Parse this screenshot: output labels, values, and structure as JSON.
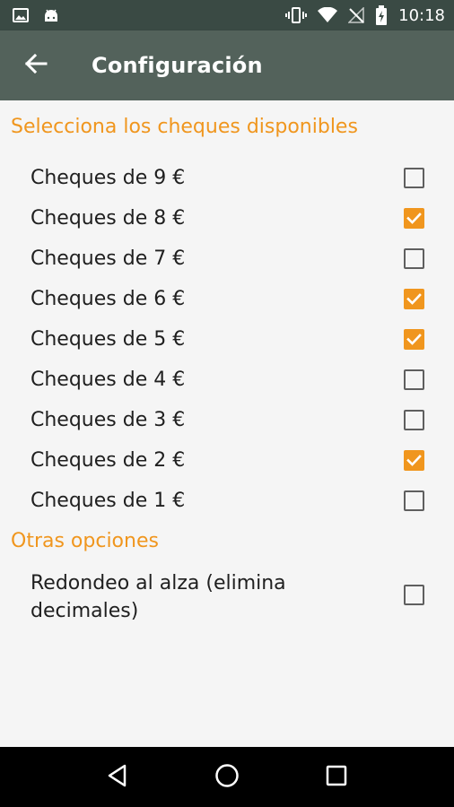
{
  "status_bar": {
    "time": "10:18",
    "left_icons": [
      "image-icon",
      "android-icon"
    ],
    "right_icons": [
      "vibrate-icon",
      "wifi-icon",
      "no-signal-icon",
      "battery-charging-icon"
    ]
  },
  "toolbar": {
    "title": "Configuración",
    "back_icon": "arrow-back-icon"
  },
  "sections": [
    {
      "header": "Selecciona los cheques disponibles",
      "items": [
        {
          "label": "Cheques de 9 €",
          "checked": false
        },
        {
          "label": "Cheques de 8 €",
          "checked": true
        },
        {
          "label": "Cheques de 7 €",
          "checked": false
        },
        {
          "label": "Cheques de 6 €",
          "checked": true
        },
        {
          "label": "Cheques de 5 €",
          "checked": true
        },
        {
          "label": "Cheques de 4 €",
          "checked": false
        },
        {
          "label": "Cheques de 3 €",
          "checked": false
        },
        {
          "label": "Cheques de 2 €",
          "checked": true
        },
        {
          "label": "Cheques de 1 €",
          "checked": false
        }
      ]
    },
    {
      "header": "Otras opciones",
      "items": [
        {
          "label": "Redondeo al alza (elimina decimales)",
          "checked": false
        }
      ]
    }
  ],
  "nav_bar": {
    "icons": [
      "back-triangle-icon",
      "home-circle-icon",
      "recents-square-icon"
    ]
  },
  "colors": {
    "accent": "#f0961e",
    "toolbar": "#53625b",
    "status_bar": "#3a4a44"
  }
}
